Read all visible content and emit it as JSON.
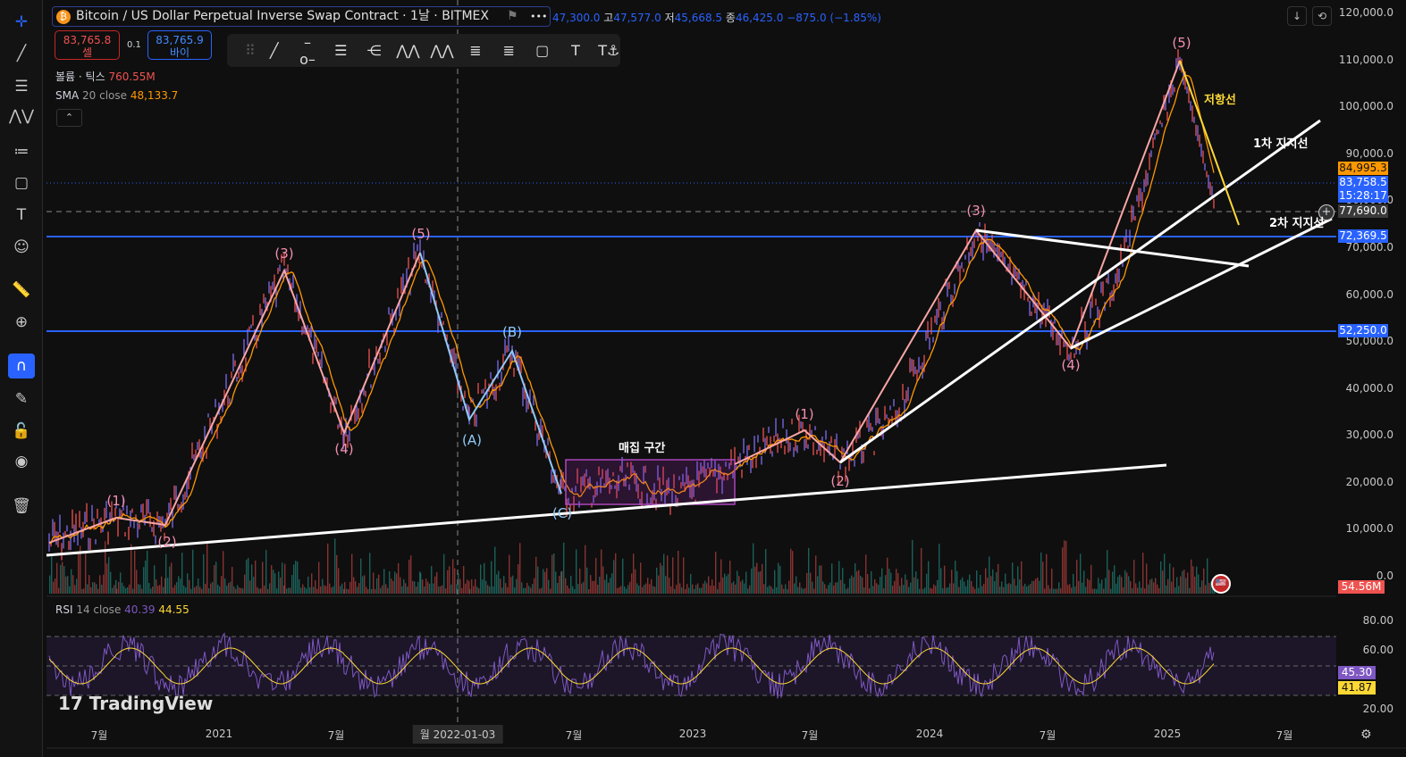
{
  "header": {
    "title": "Bitcoin / US Dollar Perpetual Inverse Swap Contract · 1날 · BITMEX",
    "more": "•••",
    "open": "47,300.0",
    "high_label": "고",
    "high": "47,577.0",
    "low_label": "저",
    "low": "45,668.5",
    "close_label": "종",
    "close": "46,425.0",
    "change": "−875.0 (−1.85%)"
  },
  "trade": {
    "sell_price": "83,765.8",
    "sell_label": "셀",
    "spread": "0.1",
    "buy_price": "83,765.9",
    "buy_label": "바이"
  },
  "legend": {
    "volume_label": "볼륨 · 틱스",
    "volume_value": "760.55M",
    "sma_label": "SMA",
    "sma_params": "20 close",
    "sma_value": "48,133.7",
    "rsi_label": "RSI",
    "rsi_params": "14 close",
    "rsi_value1": "40.39",
    "rsi_value2": "44.55"
  },
  "drawing_toolbar": [
    "trend-line",
    "horizontal-ray",
    "parallel-channel",
    "pitchfork",
    "elliott-impulse",
    "elliott-correction",
    "fib-retracement",
    "fib-extension",
    "rectangle",
    "text",
    "anchored-text"
  ],
  "left_toolbar": [
    "crosshair",
    "trend-line",
    "fib",
    "patterns",
    "forecast",
    "shapes",
    "text",
    "emoji",
    "ruler",
    "zoom",
    "magnet",
    "lock-drawings",
    "lock",
    "eye",
    "trash"
  ],
  "price_axis": [
    "120,000.0",
    "110,000.0",
    "100,000.0",
    "90,000.0",
    "80,000.0",
    "70,000.0",
    "60,000.0",
    "50,000.0",
    "40,000.0",
    "30,000.0",
    "20,000.0",
    "10,000.0",
    "0.0"
  ],
  "price_tags": {
    "sma": "84,995.3",
    "last": "83,758.5",
    "countdown": "15:28:17",
    "cursor": "77,690.0",
    "hline1": "72,369.5",
    "hline2": "52,250.0",
    "volume": "54.56M"
  },
  "rsi_axis": [
    "80.00",
    "60.00",
    "20.00"
  ],
  "rsi_tags": {
    "rsi": "45.30",
    "ma": "41.87"
  },
  "time_axis": [
    "7월",
    "2021",
    "7월",
    "2022-01-03",
    "7월",
    "2023",
    "7월",
    "2024",
    "7월",
    "2025",
    "7월"
  ],
  "cursor_date_prefix": "월",
  "waves": [
    "(1)",
    "(2)",
    "(3)",
    "(4)",
    "(5)",
    "(A)",
    "(B)",
    "(C)",
    "(1)",
    "(2)",
    "(3)",
    "(4)",
    "(5)"
  ],
  "annotations": {
    "accumulation": "매집 구간",
    "resistance": "저항선",
    "support1": "1차 지지선",
    "support2": "2차 지지선"
  },
  "brand": "TradingView",
  "colors": {
    "up": "#26a69a",
    "down": "#ef5350",
    "sma": "#ff9800",
    "wave": "#f48fb1",
    "correction": "#90caf9",
    "hline": "#2962ff",
    "rsi": "#7e57c2",
    "rsi_ma": "#fdd835"
  }
}
